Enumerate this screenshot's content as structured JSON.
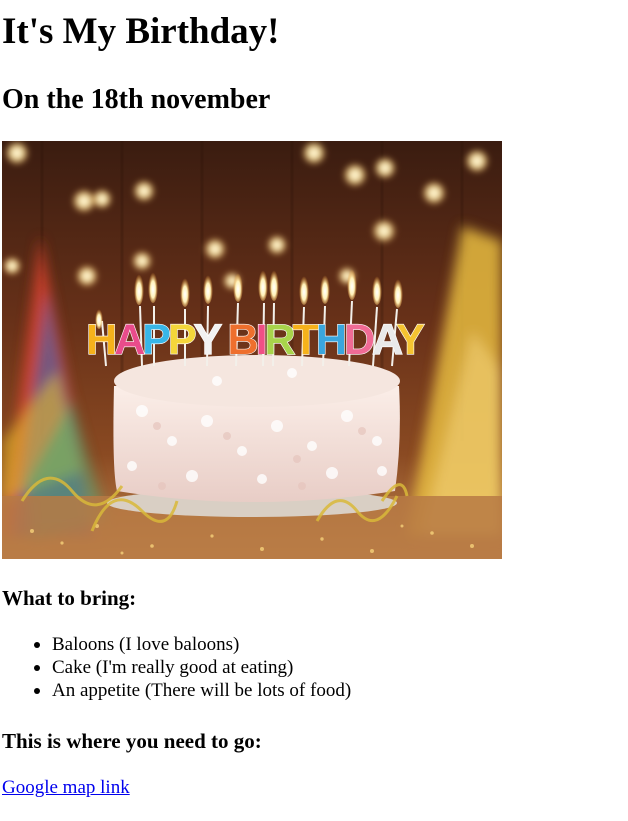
{
  "page": {
    "title": "It's My Birthday!",
    "subtitle": "On the 18th november"
  },
  "image": {
    "alt": "Birthday cake",
    "candle_text": "HAPPY BIRTHDAY",
    "candle_colors": [
      "#f6b21b",
      "#e94c8b",
      "#38b6e8",
      "#f4d63a",
      "#f2f2f2",
      "#ee6f2d",
      "#f04f86",
      "#a8d44b",
      "#f6b21b",
      "#3aa6dd",
      "#f06b95",
      "#e9e9e9",
      "#f5c431"
    ]
  },
  "bring": {
    "heading": "What to bring:",
    "items": [
      "Baloons (I love baloons)",
      "Cake (I'm really good at eating)",
      "An appetite (There will be lots of food)"
    ]
  },
  "directions": {
    "heading": "This is where you need to go:",
    "link_text": "Google map link"
  }
}
